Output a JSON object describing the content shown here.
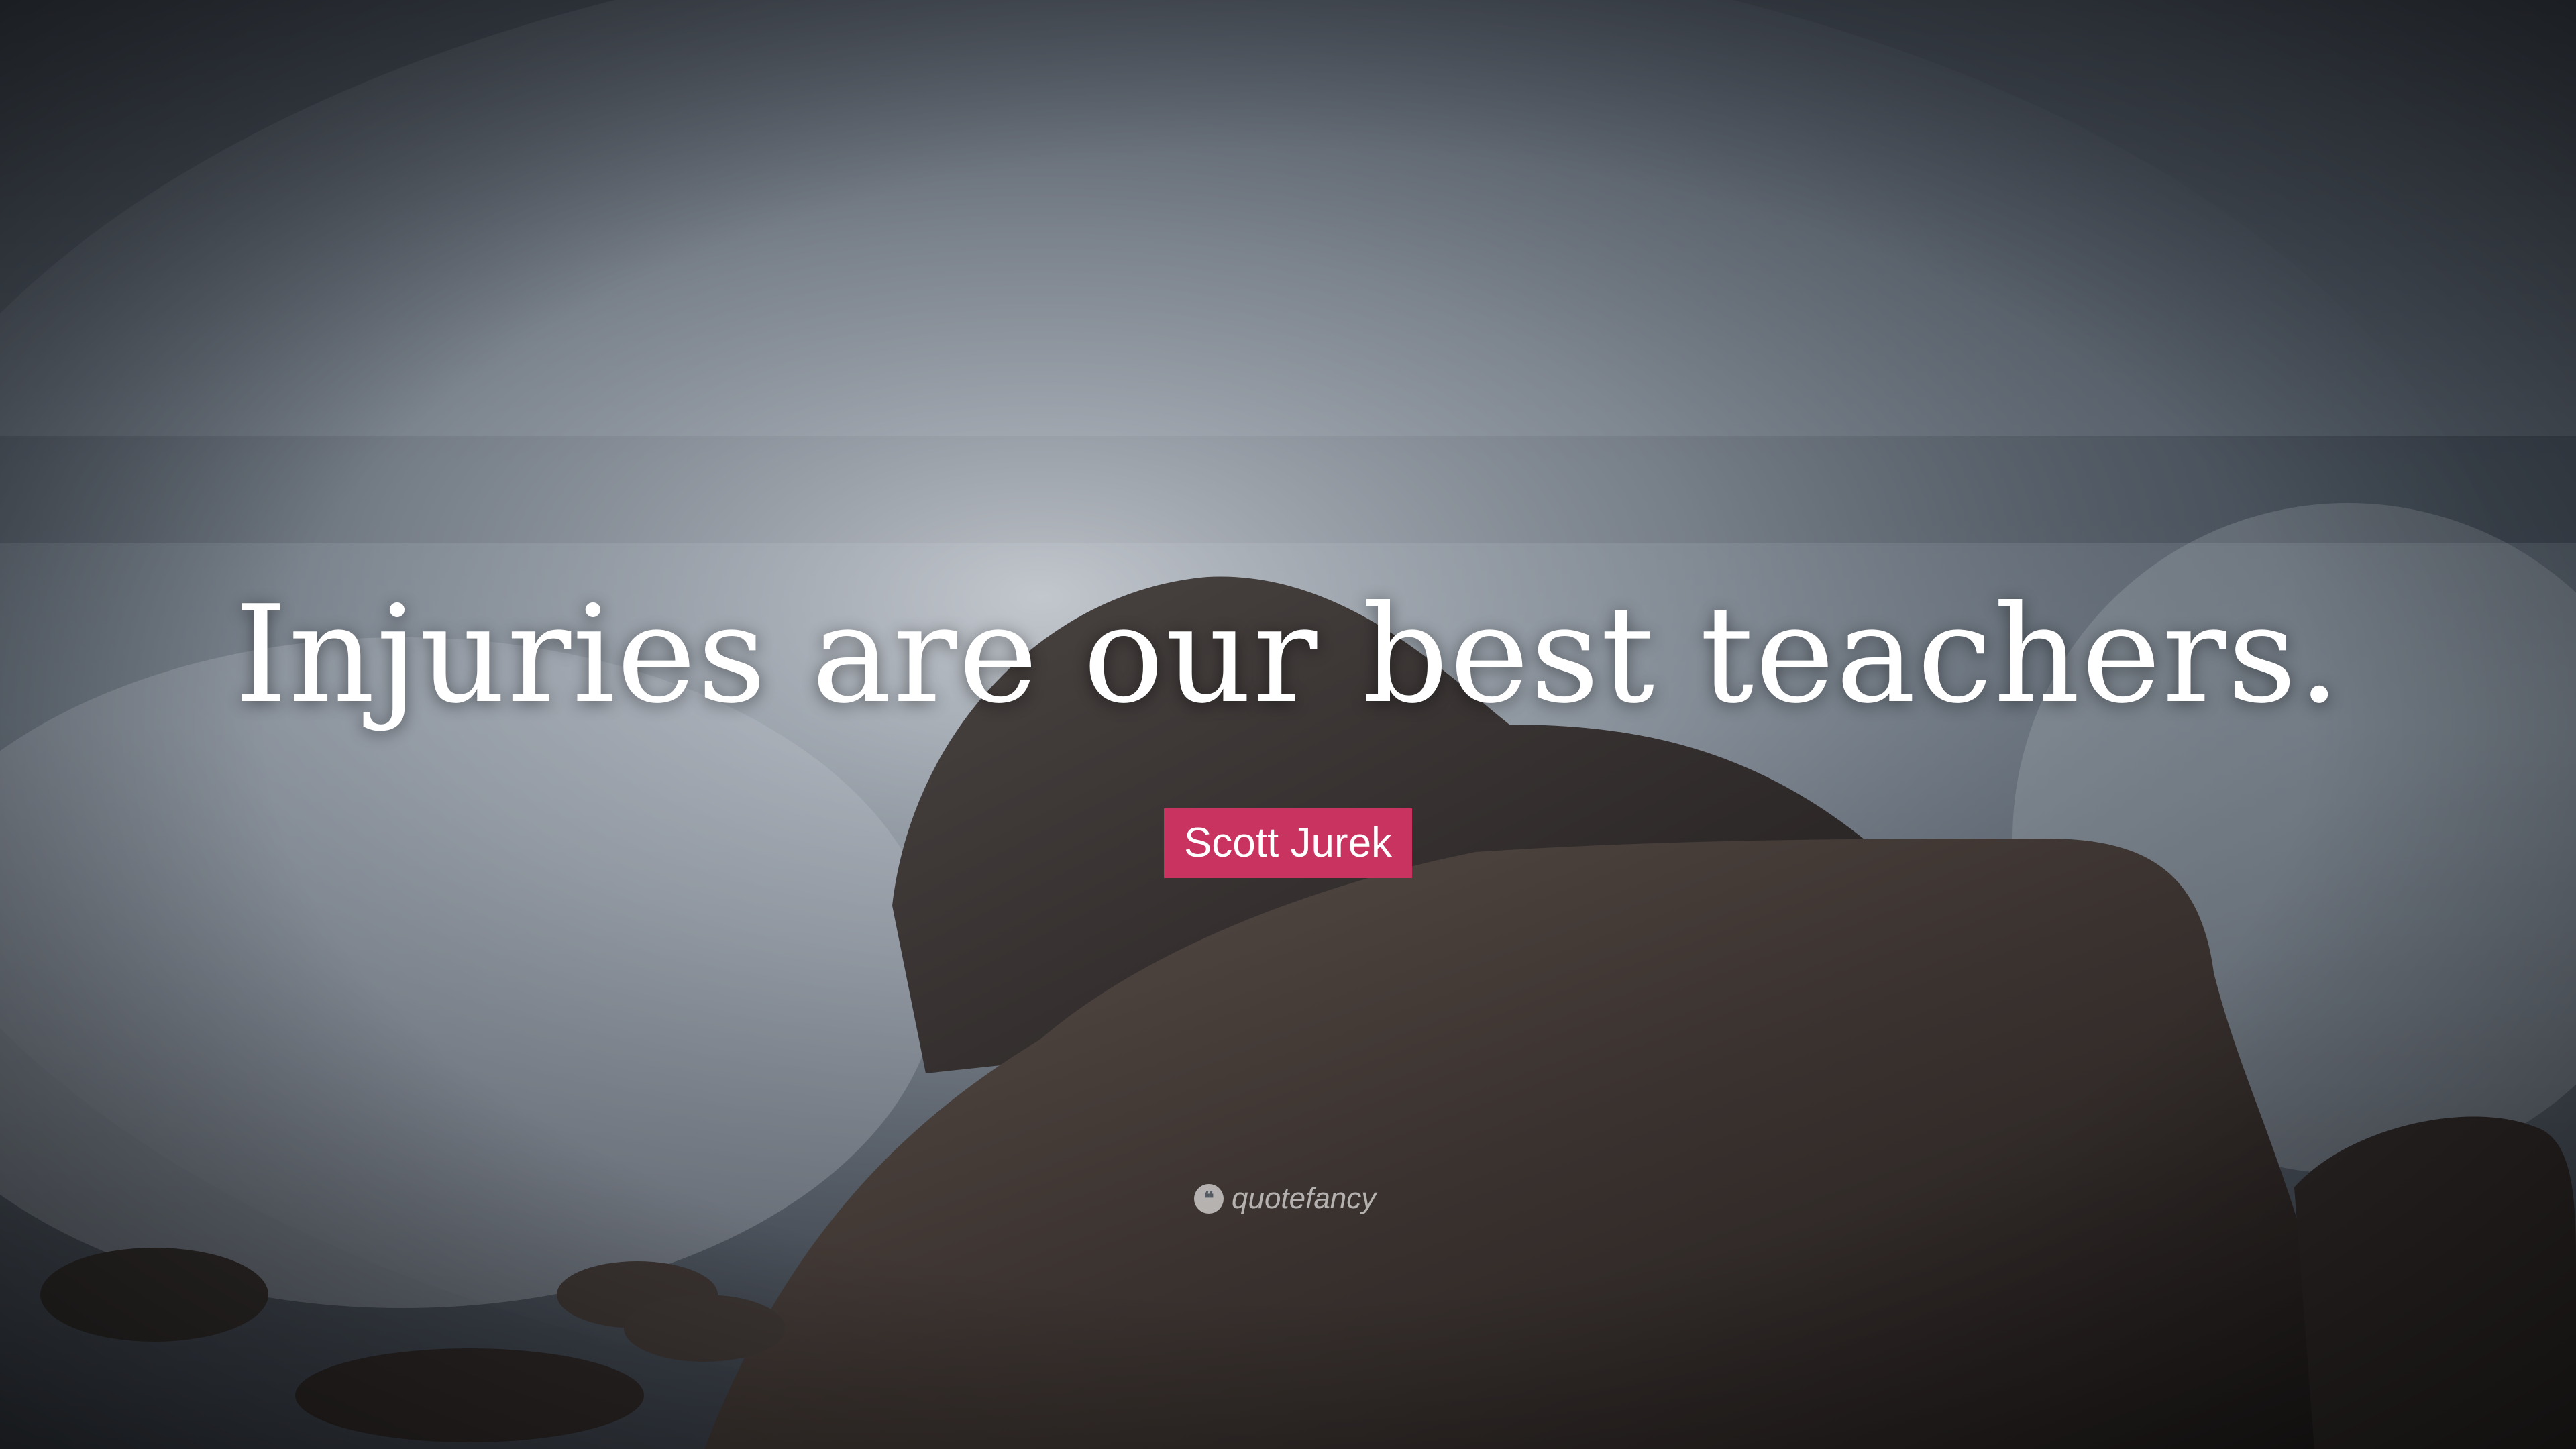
{
  "quote": {
    "text": "Injuries are our best teachers."
  },
  "author": {
    "name": "Scott Jurek"
  },
  "brand": {
    "name": "quotefancy",
    "icon": "quote-mark-icon"
  },
  "colors": {
    "author_badge": "#c8335f",
    "sky": "#4a535e",
    "rock": "#2f2a29",
    "spray": "#d9dde2"
  }
}
